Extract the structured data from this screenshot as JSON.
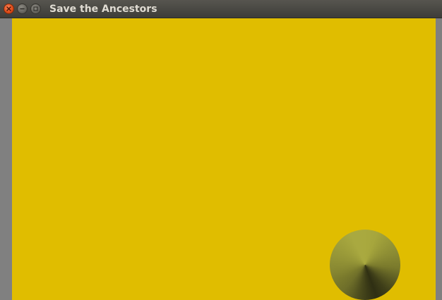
{
  "window": {
    "title": "Save the Ancestors"
  },
  "controls": {
    "close_icon": "close-icon",
    "minimize_icon": "minimize-icon",
    "maximize_icon": "maximize-icon"
  },
  "game": {
    "background_color": "#e0bd00",
    "object": "cone"
  },
  "colors": {
    "titlebar": "#3e3d39",
    "title_text": "#dfdbd2",
    "side_gutter": "#808080",
    "close_button": "#df4a16"
  }
}
